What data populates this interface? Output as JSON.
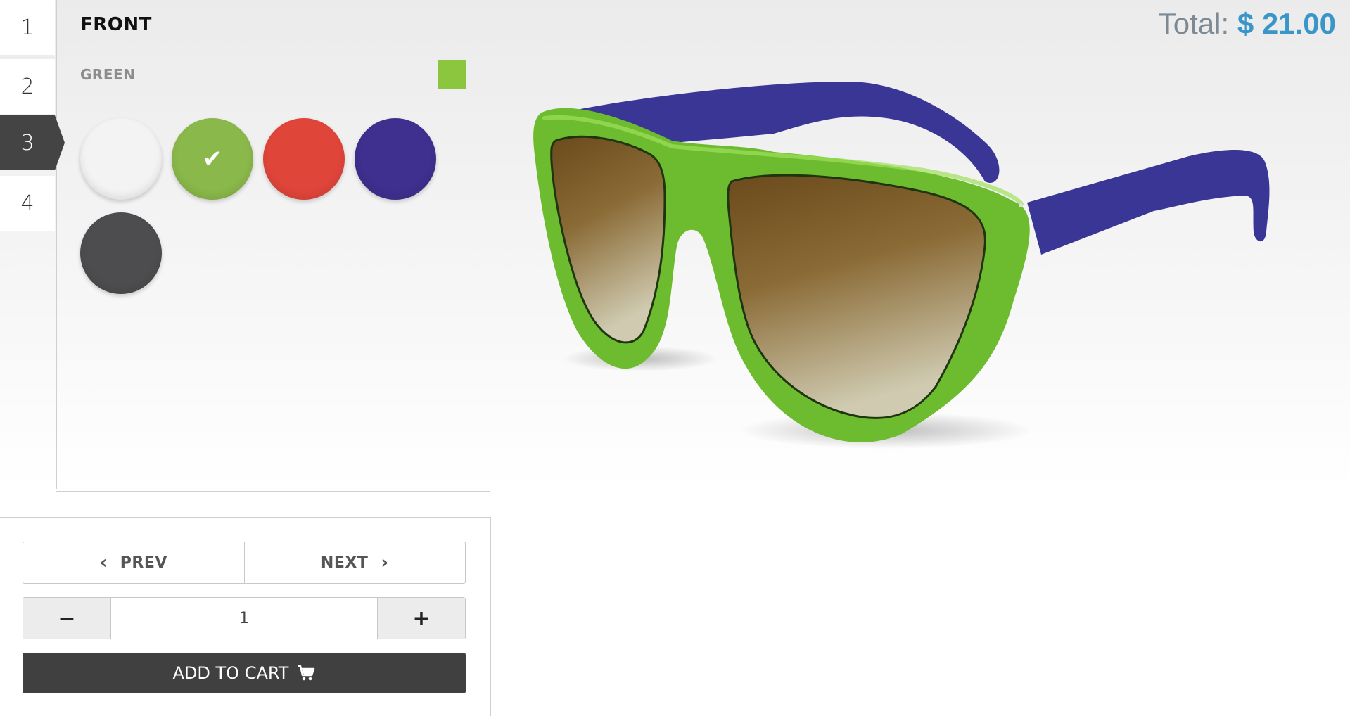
{
  "steps": [
    {
      "label": "1",
      "active": false
    },
    {
      "label": "2",
      "active": false
    },
    {
      "label": "3",
      "active": true
    },
    {
      "label": "4",
      "active": false
    }
  ],
  "panel": {
    "title": "FRONT",
    "selected_color_name": "GREEN",
    "selected_color_hex": "#8cc63f",
    "swatches": [
      {
        "name": "white",
        "hex": "#f3f3f3",
        "selected": false
      },
      {
        "name": "green",
        "hex": "#8ab84a",
        "selected": true
      },
      {
        "name": "red",
        "hex": "#e0453a",
        "selected": false
      },
      {
        "name": "blue",
        "hex": "#3f2f8e",
        "selected": false
      },
      {
        "name": "dark-gray",
        "hex": "#4d4d4f",
        "selected": false
      }
    ]
  },
  "controls": {
    "prev_label": "PREV",
    "next_label": "NEXT",
    "quantity": "1",
    "minus_label": "−",
    "plus_label": "+",
    "add_to_cart_label": "ADD TO CART"
  },
  "total": {
    "label": "Total:",
    "amount": "$ 21.00"
  },
  "colors": {
    "frame_front": "#6dbb2f",
    "temples": "#3a3696",
    "accent_total": "#3a96c8",
    "dark_button": "#404040"
  }
}
